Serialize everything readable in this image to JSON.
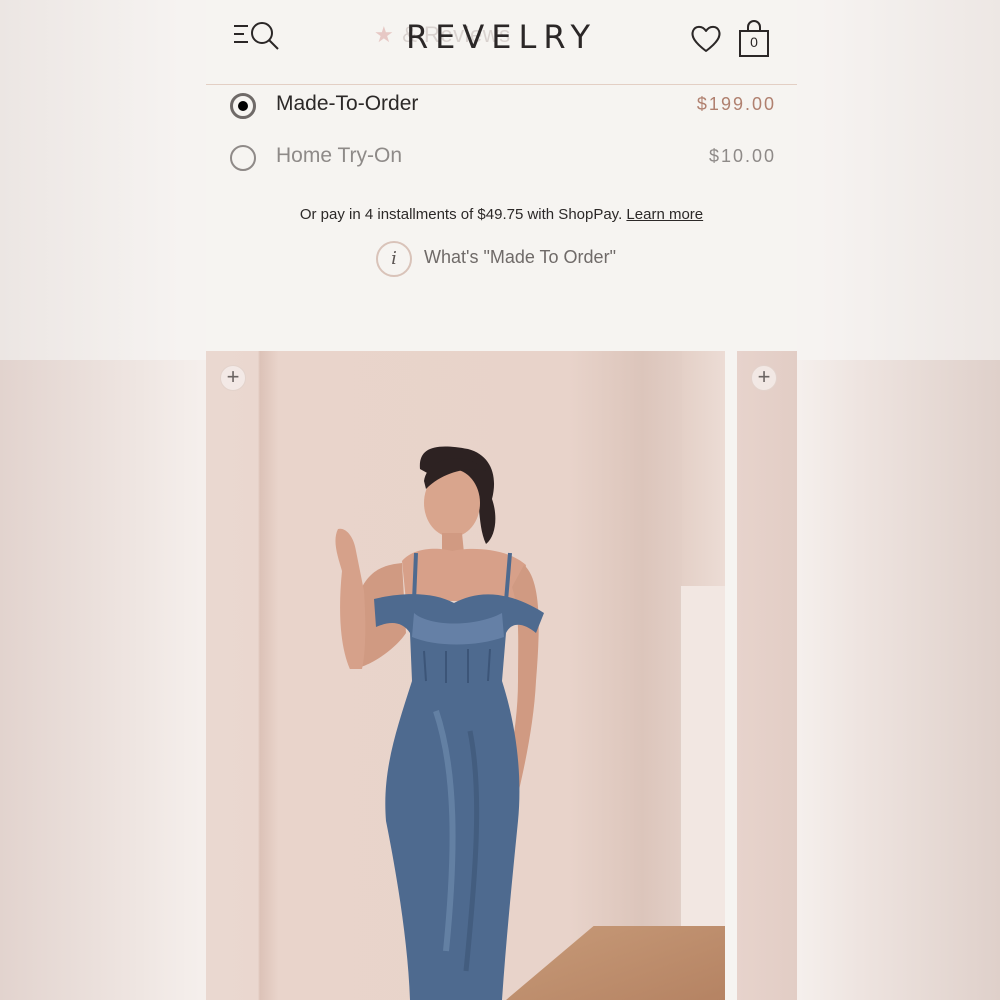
{
  "header": {
    "logo": "REVELRY",
    "behind_text": "& Reviews",
    "star_glyph": "★",
    "bag_count": "0",
    "menu_search_icon": "menu-search-icon",
    "wishlist_icon": "heart-icon",
    "bag_icon": "shopping-bag-icon"
  },
  "purchase_options": [
    {
      "label": "Made-To-Order",
      "price": "$199.00",
      "selected": true
    },
    {
      "label": "Home Try-On",
      "price": "$10.00",
      "selected": false
    }
  ],
  "installments": {
    "text": "Or pay in 4 installments of $49.75 with ShopPay.",
    "link": "Learn more"
  },
  "made_to_order_info": {
    "icon_glyph": "i",
    "label": "What's \"Made To Order\""
  },
  "gallery": {
    "zoom_glyph": "+",
    "dress_color": "#4e6a8f",
    "accent_color": "#b0806f"
  }
}
